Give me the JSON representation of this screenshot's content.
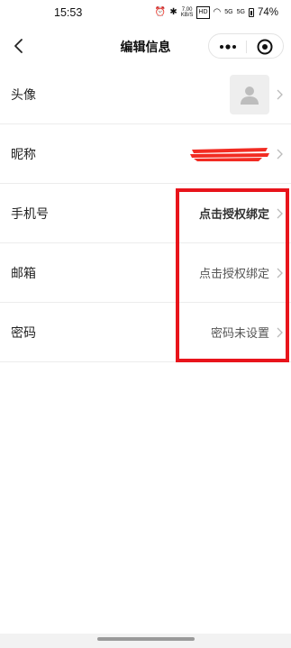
{
  "status_bar": {
    "time": "15:53",
    "net_speed_value": "7.00",
    "net_speed_unit": "KB/S",
    "hd_badge": "HD",
    "signal_1": "5G",
    "signal_2": "5G",
    "battery": "74%"
  },
  "nav": {
    "title": "编辑信息"
  },
  "rows": [
    {
      "label": "头像",
      "value": ""
    },
    {
      "label": "昵称",
      "value": ""
    },
    {
      "label": "手机号",
      "value": "点击授权绑定"
    },
    {
      "label": "邮箱",
      "value": "点击授权绑定"
    },
    {
      "label": "密码",
      "value": "密码未设置"
    }
  ],
  "colors": {
    "highlight": "#e8141b",
    "divider": "#ececec",
    "avatar_bg": "#eeeeee"
  },
  "icons": [
    "back-icon",
    "more-icon",
    "target-icon",
    "chevron-right-icon",
    "user-icon"
  ]
}
